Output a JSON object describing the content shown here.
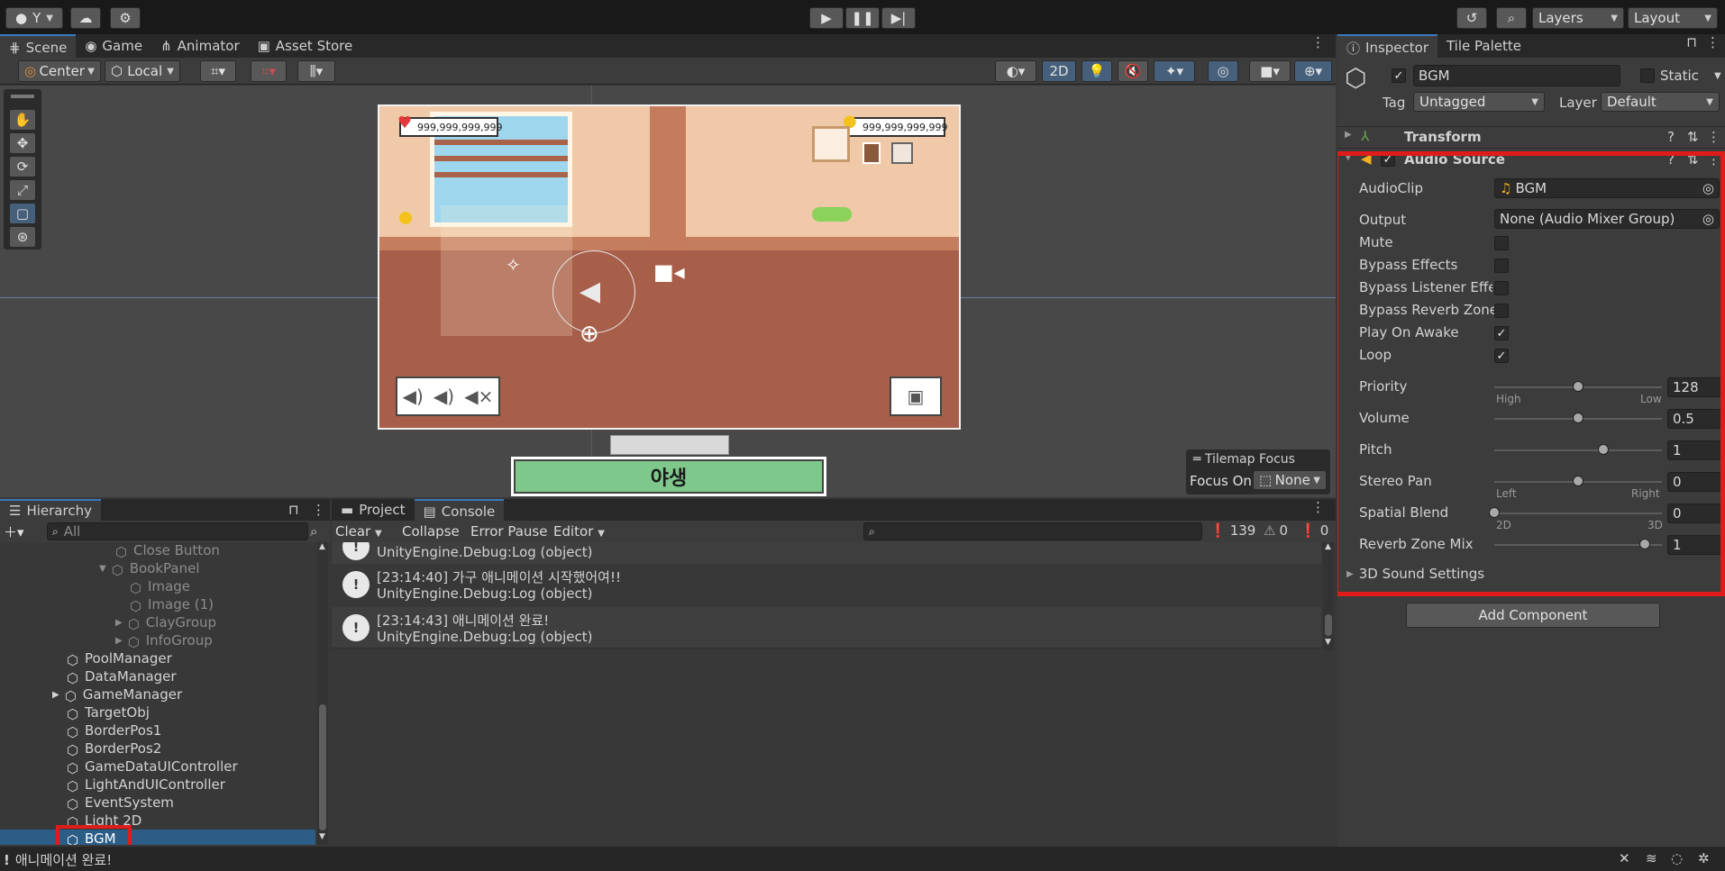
{
  "toolbar": {
    "account_label": "Y",
    "layers_label": "Layers",
    "layout_label": "Layout"
  },
  "scene_tabs": [
    {
      "label": "Scene"
    },
    {
      "label": "Game"
    },
    {
      "label": "Animator"
    },
    {
      "label": "Asset Store"
    }
  ],
  "scene_toolbar": {
    "pivot_label": "Center",
    "space_label": "Local",
    "mode_2d_label": "2D"
  },
  "game_view": {
    "left_counter": "999,999,999,999",
    "right_counter": "999,999,999,999",
    "button_text": "야생"
  },
  "tilemap_focus": {
    "title": "Tilemap Focus",
    "focus_label": "Focus On",
    "focus_value": "None"
  },
  "hierarchy": {
    "tab_label": "Hierarchy",
    "search_placeholder": "All",
    "items": [
      {
        "label": "Close Button"
      },
      {
        "label": "BookPanel"
      },
      {
        "label": "Image"
      },
      {
        "label": "Image (1)"
      },
      {
        "label": "ClayGroup"
      },
      {
        "label": "InfoGroup"
      },
      {
        "label": "PoolManager"
      },
      {
        "label": "DataManager"
      },
      {
        "label": "GameManager"
      },
      {
        "label": "TargetObj"
      },
      {
        "label": "BorderPos1"
      },
      {
        "label": "BorderPos2"
      },
      {
        "label": "GameDataUIController"
      },
      {
        "label": "LightAndUIController"
      },
      {
        "label": "EventSystem"
      },
      {
        "label": "Light 2D"
      },
      {
        "label": "BGM"
      }
    ]
  },
  "console": {
    "tabs": [
      {
        "label": "Project"
      },
      {
        "label": "Console"
      }
    ],
    "clear_label": "Clear",
    "collapse_label": "Collapse",
    "error_pause_label": "Error Pause",
    "editor_label": "Editor",
    "log_count": "139",
    "warn_count": "0",
    "error_count": "0",
    "entries": [
      {
        "line1": "",
        "line2": "UnityEngine.Debug:Log (object)"
      },
      {
        "line1": "[23:14:40] 가구 애니메이션 시작했어여!!",
        "line2": "UnityEngine.Debug:Log (object)"
      },
      {
        "line1": "[23:14:43] 애니메이션 완료!",
        "line2": "UnityEngine.Debug:Log (object)"
      }
    ]
  },
  "status_bar": {
    "message": "애니메이션 완료!"
  },
  "inspector": {
    "tabs": [
      {
        "label": "Inspector"
      },
      {
        "label": "Tile Palette"
      }
    ],
    "object_name": "BGM",
    "static_label": "Static",
    "tag_label": "Tag",
    "tag_value": "Untagged",
    "layer_label": "Layer",
    "layer_value": "Default",
    "transform_label": "Transform",
    "audio_source_label": "Audio Source",
    "audio_clip_label": "AudioClip",
    "audio_clip_value": "BGM",
    "output_label": "Output",
    "output_value": "None (Audio Mixer Group)",
    "mute_label": "Mute",
    "bypass_effects_label": "Bypass Effects",
    "bypass_listener_label": "Bypass Listener Effe",
    "bypass_reverb_label": "Bypass Reverb Zone",
    "play_on_awake_label": "Play On Awake",
    "loop_label": "Loop",
    "priority_label": "Priority",
    "priority_value": "128",
    "priority_fraction": 0.5,
    "priority_min_label": "High",
    "priority_max_label": "Low",
    "volume_label": "Volume",
    "volume_value": "0.5",
    "volume_fraction": 0.5,
    "pitch_label": "Pitch",
    "pitch_value": "1",
    "pitch_fraction": 0.65,
    "stereo_pan_label": "Stereo Pan",
    "stereo_pan_value": "0",
    "stereo_pan_fraction": 0.5,
    "stereo_min_label": "Left",
    "stereo_max_label": "Right",
    "spatial_blend_label": "Spatial Blend",
    "spatial_blend_value": "0",
    "spatial_blend_fraction": 0.0,
    "spatial_min_label": "2D",
    "spatial_max_label": "3D",
    "reverb_mix_label": "Reverb Zone Mix",
    "reverb_mix_value": "1",
    "reverb_mix_fraction": 0.9,
    "sound_settings_label": "3D Sound Settings",
    "add_component_label": "Add Component"
  },
  "colors": {
    "highlight_red": "#e01b1b",
    "selection_blue": "#2c5d87",
    "accent_blue": "#3a79bb"
  }
}
